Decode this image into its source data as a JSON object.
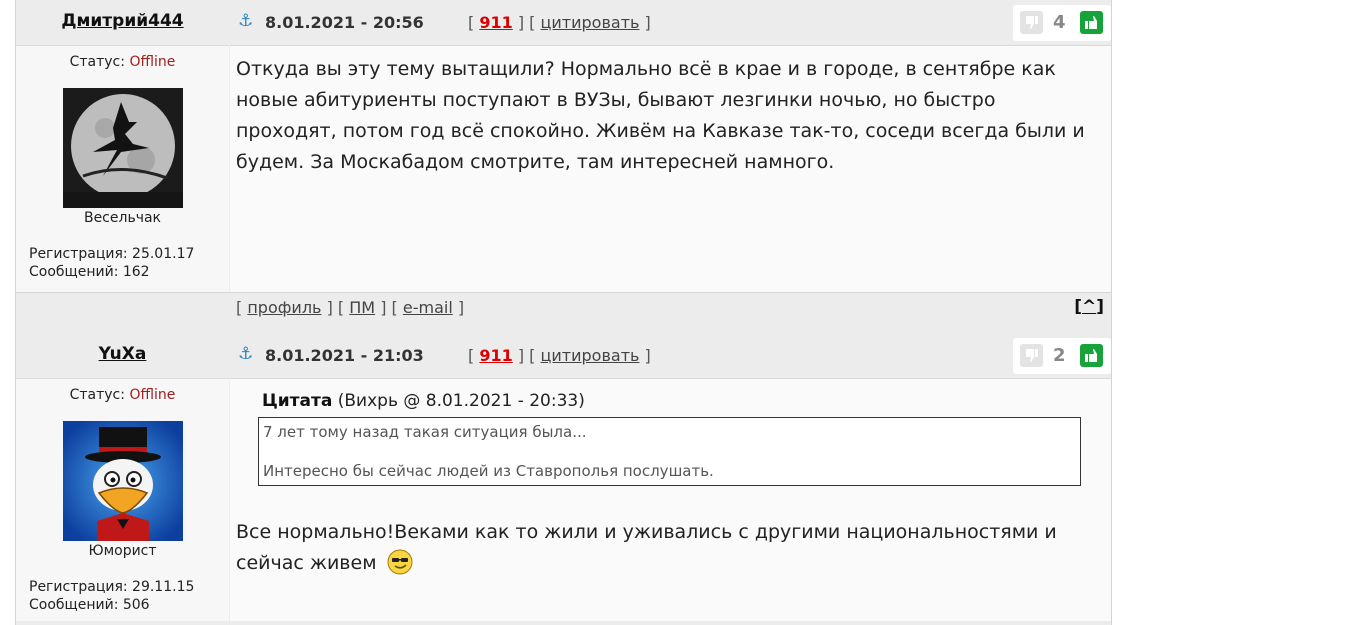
{
  "posts": [
    {
      "username": "Дмитрий444",
      "status_label": "Статус:",
      "status_value": "Offline",
      "rank": "Весельчак",
      "registration": "Регистрация: 25.01.17",
      "messages": "Сообщений: 162",
      "anchor_icon": "anchor-icon",
      "date": "8.01.2021 - 20:56",
      "bracket_open": "[",
      "post_number": "911",
      "bracket_sep": "] [",
      "quote_link": "цитировать",
      "bracket_close": "]",
      "score": "4",
      "text": "Откуда вы эту тему вытащили? Нормально всё в крае и в городе, в сентябре как новые абитуриенты поступают в ВУЗы, бывают лезгинки ночью, но быстро проходят, потом год всё спокойно. Живём на Кавказе так-то, соседи всегда были и будем. За Москабадом смотрите, там интересней намного.",
      "footer": {
        "b1": "[",
        "profile": "профиль",
        "b2": "] [",
        "pm": "ПМ",
        "b3": "] [",
        "email": "e-mail",
        "b4": "]",
        "top_open": "[",
        "top": "^",
        "top_close": "]"
      }
    },
    {
      "username": "YuXa",
      "status_label": "Статус:",
      "status_value": "Offline",
      "rank": "Юморист",
      "registration": "Регистрация: 29.11.15",
      "messages": "Сообщений: 506",
      "anchor_icon": "anchor-icon",
      "date": "8.01.2021 - 21:03",
      "bracket_open": "[",
      "post_number": "911",
      "bracket_sep": "] [",
      "quote_link": "цитировать",
      "bracket_close": "]",
      "score": "2",
      "quote": {
        "label": "Цитата",
        "source": "(Вихрь @ 8.01.2021 - 20:33)",
        "line1": "7 лет тому назад такая ситуация была...",
        "line2": "Интересно бы сейчас людей из Ставрополья послушать."
      },
      "text": "Все нормально!Веками как то жили и уживались с другими национальностями и сейчас живем",
      "emoji": "cool-smiley-emoji"
    }
  ],
  "colors": {
    "offline": "#a02020",
    "post_number": "#dd0000",
    "thumb_up": "#18a33a",
    "anchor": "#2a83b5"
  }
}
